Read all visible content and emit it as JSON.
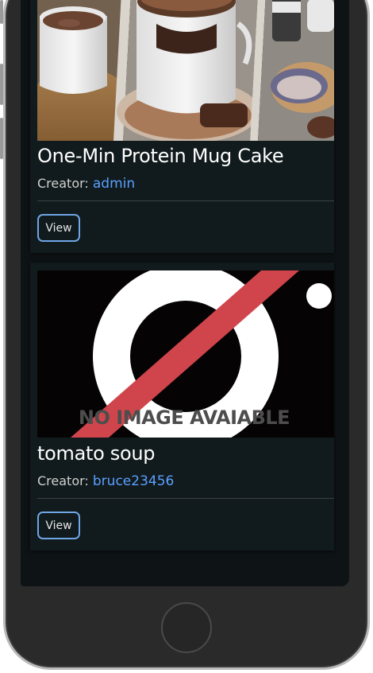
{
  "cards": [
    {
      "title": "One-Min Protein Mug Cake",
      "creator_label": "Creator:",
      "creator_name": "admin",
      "view_label": "View"
    },
    {
      "title": "tomato soup",
      "creator_label": "Creator:",
      "creator_name": "bruce23456",
      "view_label": "View",
      "placeholder_text": "NO IMAGE AVAIABLE"
    }
  ],
  "colors": {
    "link": "#5aa0ff",
    "button_border": "#6fa6e6",
    "no_image_slash": "#d0454c"
  }
}
